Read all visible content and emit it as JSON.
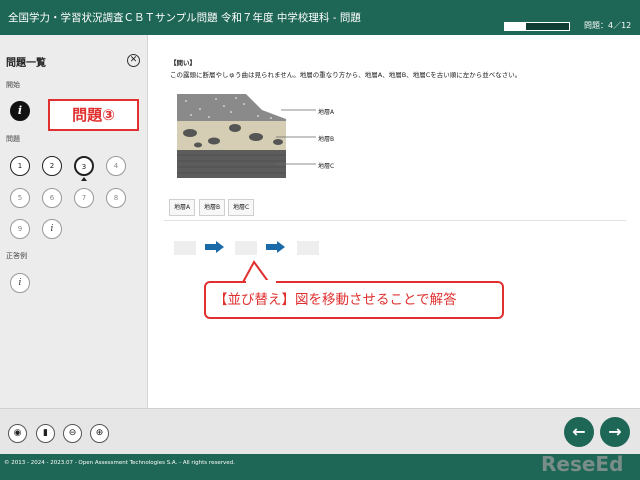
{
  "header": {
    "title": "全国学力・学習状況調査ＣＢＴサンプル問題 令和７年度 中学校理科 - 問題",
    "progress": 0.33,
    "counter": "問題：4／12"
  },
  "sidebar": {
    "title": "問題一覧",
    "close_icon": "close-icon",
    "sections": {
      "start": "開始",
      "questions": "問題",
      "answers": "正答例"
    },
    "start_item": "i",
    "question_items": [
      "1",
      "2",
      "3",
      "4",
      "5",
      "6",
      "7",
      "8",
      "9",
      "i"
    ],
    "answer_item": "i",
    "current_index": 2
  },
  "callout_top": "問題③",
  "question": {
    "heading": "【問い】",
    "text": "この露頭に断層やしゅう曲は見られません。地層の重なり方から、地層A、地層B、地層Cを古い順に左から並べなさい。",
    "layers": [
      "地層A",
      "地層B",
      "地層C"
    ]
  },
  "choices": [
    "地層A",
    "地層B",
    "地層C"
  ],
  "callout_bottom": "【並び替え】図を移動させることで解答",
  "toolbar": {
    "tools": [
      "hide-icon",
      "bookmark-icon",
      "zoom-out-icon",
      "zoom-in-icon"
    ],
    "prev": "←",
    "next": "→"
  },
  "footer": {
    "copyright": "© 2013 - 2024 - 2023.07 - Open Assessment Technologies S.A. - All rights reserved."
  },
  "watermark": "ReseEd",
  "colors": {
    "brand": "#1e6655",
    "accent": "#e03030",
    "arrow": "#1a6aa8"
  }
}
